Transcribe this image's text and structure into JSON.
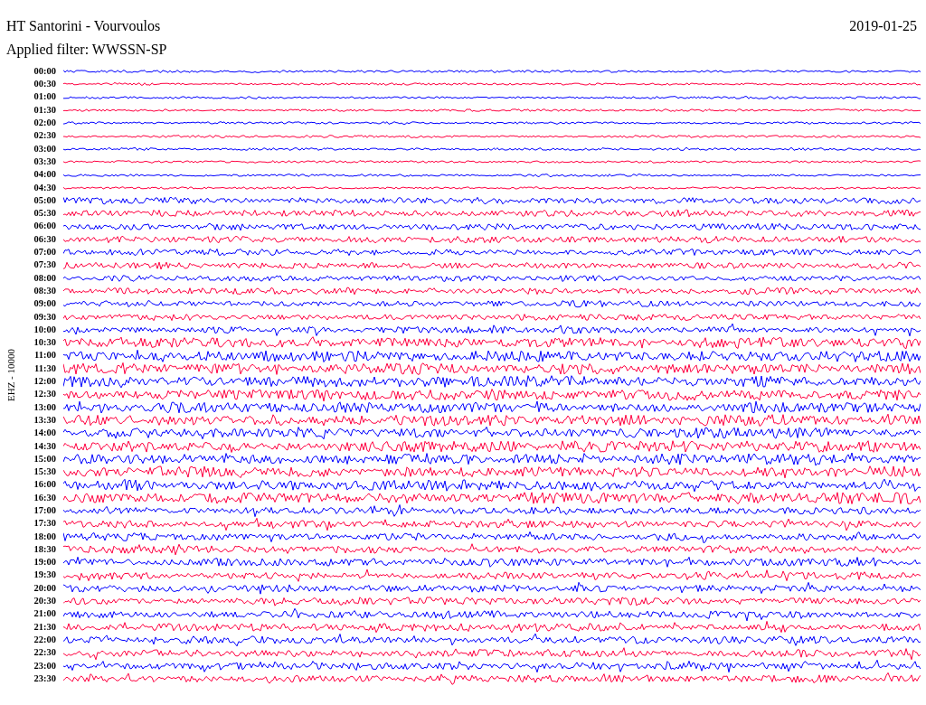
{
  "header": {
    "station": "HT Santorini - Vourvoulos",
    "date": "2019-01-25",
    "filter": "Applied filter: WWSSN-SP"
  },
  "helicorder": {
    "channel_label": "EHZ - 10000",
    "rows": [
      {
        "time": "00:00",
        "color": "#0000ff"
      },
      {
        "time": "00:30",
        "color": "#ff0040"
      },
      {
        "time": "01:00",
        "color": "#0000ff"
      },
      {
        "time": "01:30",
        "color": "#ff0040"
      },
      {
        "time": "02:00",
        "color": "#0000ff"
      },
      {
        "time": "02:30",
        "color": "#ff0040"
      },
      {
        "time": "03:00",
        "color": "#0000ff"
      },
      {
        "time": "03:30",
        "color": "#ff0040"
      },
      {
        "time": "04:00",
        "color": "#0000ff"
      },
      {
        "time": "04:30",
        "color": "#ff0040"
      },
      {
        "time": "05:00",
        "color": "#0000ff"
      },
      {
        "time": "05:30",
        "color": "#ff0040"
      },
      {
        "time": "06:00",
        "color": "#0000ff"
      },
      {
        "time": "06:30",
        "color": "#ff0040"
      },
      {
        "time": "07:00",
        "color": "#0000ff"
      },
      {
        "time": "07:30",
        "color": "#ff0040"
      },
      {
        "time": "08:00",
        "color": "#0000ff"
      },
      {
        "time": "08:30",
        "color": "#ff0040"
      },
      {
        "time": "09:00",
        "color": "#0000ff"
      },
      {
        "time": "09:30",
        "color": "#ff0040"
      },
      {
        "time": "10:00",
        "color": "#0000ff"
      },
      {
        "time": "10:30",
        "color": "#ff0040"
      },
      {
        "time": "11:00",
        "color": "#0000ff"
      },
      {
        "time": "11:30",
        "color": "#ff0040"
      },
      {
        "time": "12:00",
        "color": "#0000ff"
      },
      {
        "time": "12:30",
        "color": "#ff0040"
      },
      {
        "time": "13:00",
        "color": "#0000ff"
      },
      {
        "time": "13:30",
        "color": "#ff0040"
      },
      {
        "time": "14:00",
        "color": "#0000ff"
      },
      {
        "time": "14:30",
        "color": "#ff0040"
      },
      {
        "time": "15:00",
        "color": "#0000ff"
      },
      {
        "time": "15:30",
        "color": "#ff0040"
      },
      {
        "time": "16:00",
        "color": "#0000ff"
      },
      {
        "time": "16:30",
        "color": "#ff0040"
      },
      {
        "time": "17:00",
        "color": "#0000ff"
      },
      {
        "time": "17:30",
        "color": "#ff0040"
      },
      {
        "time": "18:00",
        "color": "#0000ff"
      },
      {
        "time": "18:30",
        "color": "#ff0040"
      },
      {
        "time": "19:00",
        "color": "#0000ff"
      },
      {
        "time": "19:30",
        "color": "#ff0040"
      },
      {
        "time": "20:00",
        "color": "#0000ff"
      },
      {
        "time": "20:30",
        "color": "#ff0040"
      },
      {
        "time": "21:00",
        "color": "#0000ff"
      },
      {
        "time": "21:30",
        "color": "#ff0040"
      },
      {
        "time": "22:00",
        "color": "#0000ff"
      },
      {
        "time": "22:30",
        "color": "#ff0040"
      },
      {
        "time": "23:00",
        "color": "#0000ff"
      },
      {
        "time": "23:30",
        "color": "#ff0040"
      }
    ]
  }
}
